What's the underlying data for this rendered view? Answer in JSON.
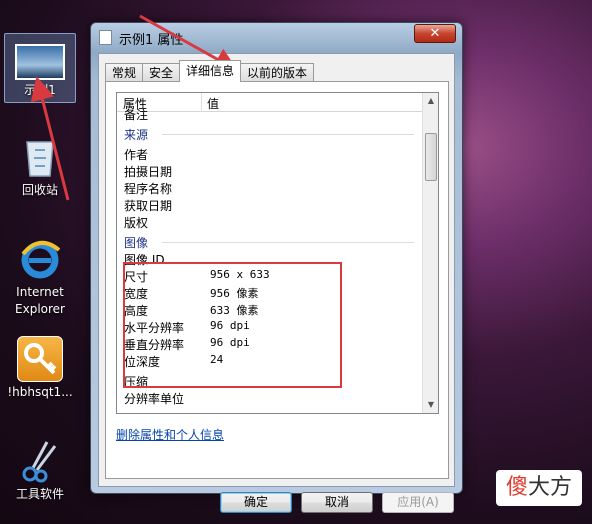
{
  "desktop": {
    "icons": [
      {
        "label": "示例1",
        "icon": "image-file-icon"
      },
      {
        "label": "回收站",
        "icon": "recycle-bin-icon"
      },
      {
        "label": "Internet Explorer",
        "icon": "internet-explorer-icon"
      },
      {
        "label": "!hbhsqt1...",
        "icon": "key-app-icon"
      },
      {
        "label": "工具软件",
        "icon": "scissors-tool-icon"
      }
    ]
  },
  "dialog": {
    "title": "示例1 属性",
    "close_glyph": "✕",
    "tabs": [
      "常规",
      "安全",
      "详细信息",
      "以前的版本"
    ],
    "active_tab": "详细信息",
    "list": {
      "header_property": "属性",
      "header_value": "值",
      "cut_row": "备注",
      "group_source": "来源",
      "source_rows": [
        "作者",
        "拍摄日期",
        "程序名称",
        "获取日期",
        "版权"
      ],
      "group_image": "图像",
      "image_rows": [
        {
          "name": "图像 ID",
          "value": ""
        },
        {
          "name": "尺寸",
          "value": "956 x 633"
        },
        {
          "name": "宽度",
          "value": "956 像素"
        },
        {
          "name": "高度",
          "value": "633 像素"
        },
        {
          "name": "水平分辨率",
          "value": "96 dpi"
        },
        {
          "name": "垂直分辨率",
          "value": "96 dpi"
        },
        {
          "name": "位深度",
          "value": "24"
        },
        {
          "name": "压缩",
          "value": ""
        },
        {
          "name": "分辨率单位",
          "value": ""
        }
      ]
    },
    "remove_link": "删除属性和个人信息",
    "buttons": {
      "ok": "确定",
      "cancel": "取消",
      "apply": "应用(A)"
    }
  },
  "watermark": {
    "part1": "傻",
    "part2": "大方"
  },
  "colors": {
    "highlight_box": "#d9393f",
    "arrow": "#d9393f",
    "link": "#0645ad"
  }
}
